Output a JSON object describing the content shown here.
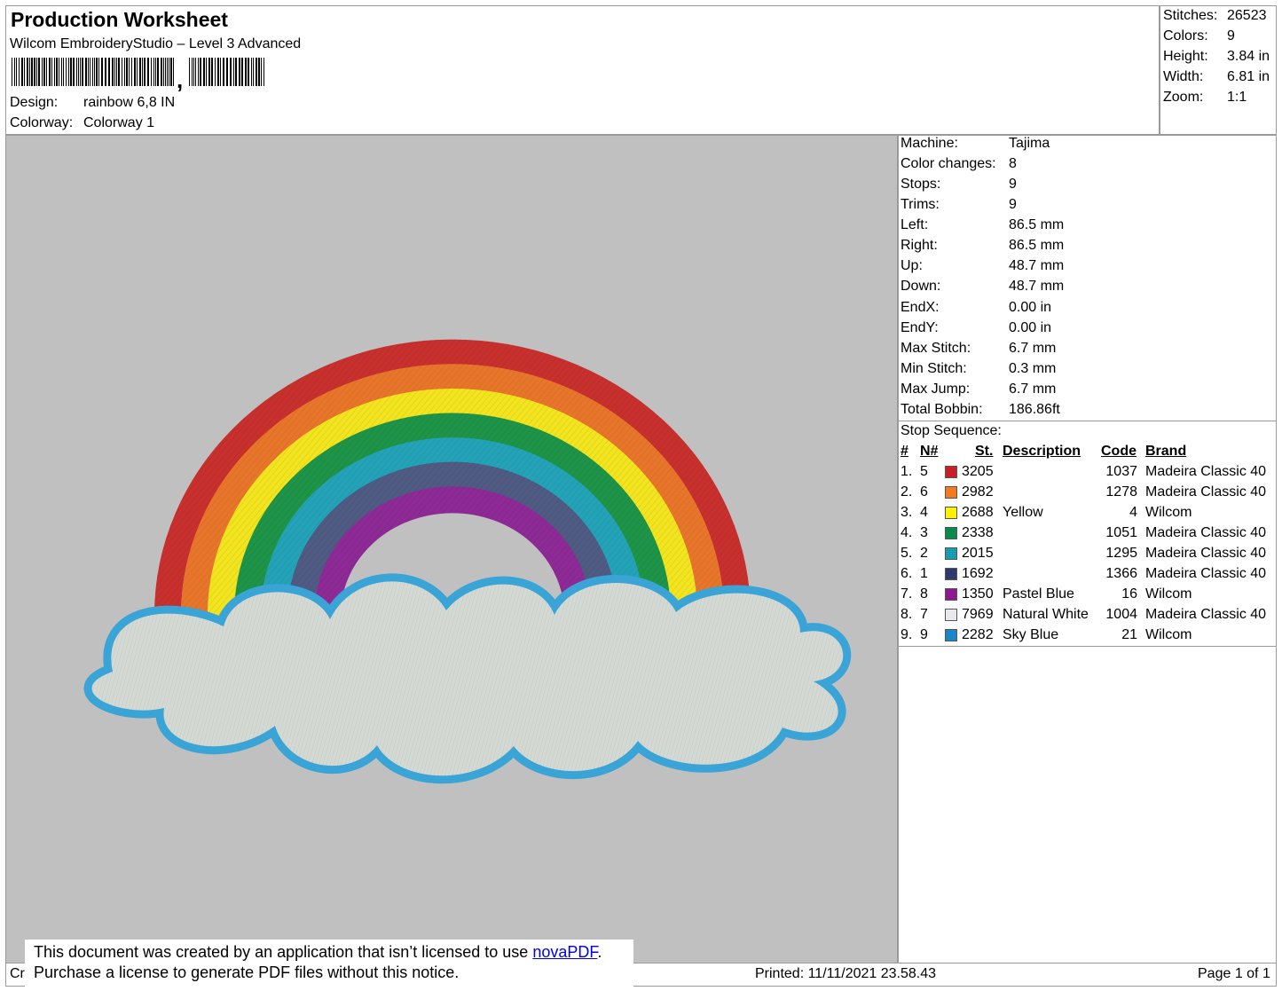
{
  "header": {
    "title": "Production Worksheet",
    "software": "Wilcom EmbroideryStudio – Level 3 Advanced",
    "design_label": "Design:",
    "design_value": "rainbow 6,8 IN",
    "colorway_label": "Colorway:",
    "colorway_value": "Colorway 1"
  },
  "stats": [
    {
      "label": "Stitches:",
      "value": "26523"
    },
    {
      "label": "Colors:",
      "value": "9"
    },
    {
      "label": "Height:",
      "value": "3.84 in"
    },
    {
      "label": "Width:",
      "value": "6.81 in"
    },
    {
      "label": "Zoom:",
      "value": "1:1"
    }
  ],
  "machine_info": [
    {
      "label": "Machine:",
      "value": "Tajima"
    },
    {
      "label": "Color changes:",
      "value": "8"
    },
    {
      "label": "Stops:",
      "value": "9"
    },
    {
      "label": "Trims:",
      "value": "9"
    },
    {
      "label": "Left:",
      "value": "86.5 mm"
    },
    {
      "label": "Right:",
      "value": "86.5 mm"
    },
    {
      "label": "Up:",
      "value": "48.7 mm"
    },
    {
      "label": "Down:",
      "value": "48.7 mm"
    },
    {
      "label": "EndX:",
      "value": "0.00 in"
    },
    {
      "label": "EndY:",
      "value": "0.00 in"
    },
    {
      "label": "Max Stitch:",
      "value": "6.7 mm"
    },
    {
      "label": "Min Stitch:",
      "value": "0.3 mm"
    },
    {
      "label": "Max Jump:",
      "value": "6.7 mm"
    },
    {
      "label": "Total Bobbin:",
      "value": "186.86ft"
    }
  ],
  "stop_sequence": {
    "title": "Stop Sequence:",
    "headers": {
      "num": "#",
      "n": "N#",
      "st": "St.",
      "description": "Description",
      "code": "Code",
      "brand": "Brand"
    },
    "rows": [
      {
        "num": "1.",
        "n": "5",
        "color": "#c8202a",
        "st": "3205",
        "description": "",
        "code": "1037",
        "brand": "Madeira Classic 40"
      },
      {
        "num": "2.",
        "n": "6",
        "color": "#f47a20",
        "st": "2982",
        "description": "",
        "code": "1278",
        "brand": "Madeira Classic 40"
      },
      {
        "num": "3.",
        "n": "4",
        "color": "#fff200",
        "st": "2688",
        "description": "Yellow",
        "code": "4",
        "brand": "Wilcom"
      },
      {
        "num": "4.",
        "n": "3",
        "color": "#0a8a4a",
        "st": "2338",
        "description": "",
        "code": "1051",
        "brand": "Madeira Classic 40"
      },
      {
        "num": "5.",
        "n": "2",
        "color": "#1a9ab0",
        "st": "2015",
        "description": "",
        "code": "1295",
        "brand": "Madeira Classic 40"
      },
      {
        "num": "6.",
        "n": "1",
        "color": "#2e3a6e",
        "st": "1692",
        "description": "",
        "code": "1366",
        "brand": "Madeira Classic 40"
      },
      {
        "num": "7.",
        "n": "8",
        "color": "#8a1a8e",
        "st": "1350",
        "description": "Pastel Blue",
        "code": "16",
        "brand": "Wilcom"
      },
      {
        "num": "8.",
        "n": "7",
        "color": "#e8e8ee",
        "st": "7969",
        "description": "Natural White",
        "code": "1004",
        "brand": "Madeira Classic 40"
      },
      {
        "num": "9.",
        "n": "9",
        "color": "#1a86c8",
        "st": "2282",
        "description": "Sky Blue",
        "code": "21",
        "brand": "Wilcom"
      }
    ]
  },
  "design_colors": {
    "canvas": "#c0c0c0",
    "bands": [
      "#c8302e",
      "#e8762a",
      "#f2e41e",
      "#1e9448",
      "#24a3b8",
      "#4f5b82",
      "#8e2a96"
    ],
    "cloud_fill": "#d4d9d4",
    "cloud_border": "#3aa4d6"
  },
  "notice": {
    "line1_before": "This document was created by an application that isn’t licensed to use ",
    "link": "novaPDF",
    "line1_after": ".",
    "line2": "Purchase a license to generate PDF files without this notice."
  },
  "footer": {
    "left_fragment": "Cr",
    "printed": "Printed: 11/11/2021 23.58.43",
    "page": "Page 1 of 1"
  }
}
